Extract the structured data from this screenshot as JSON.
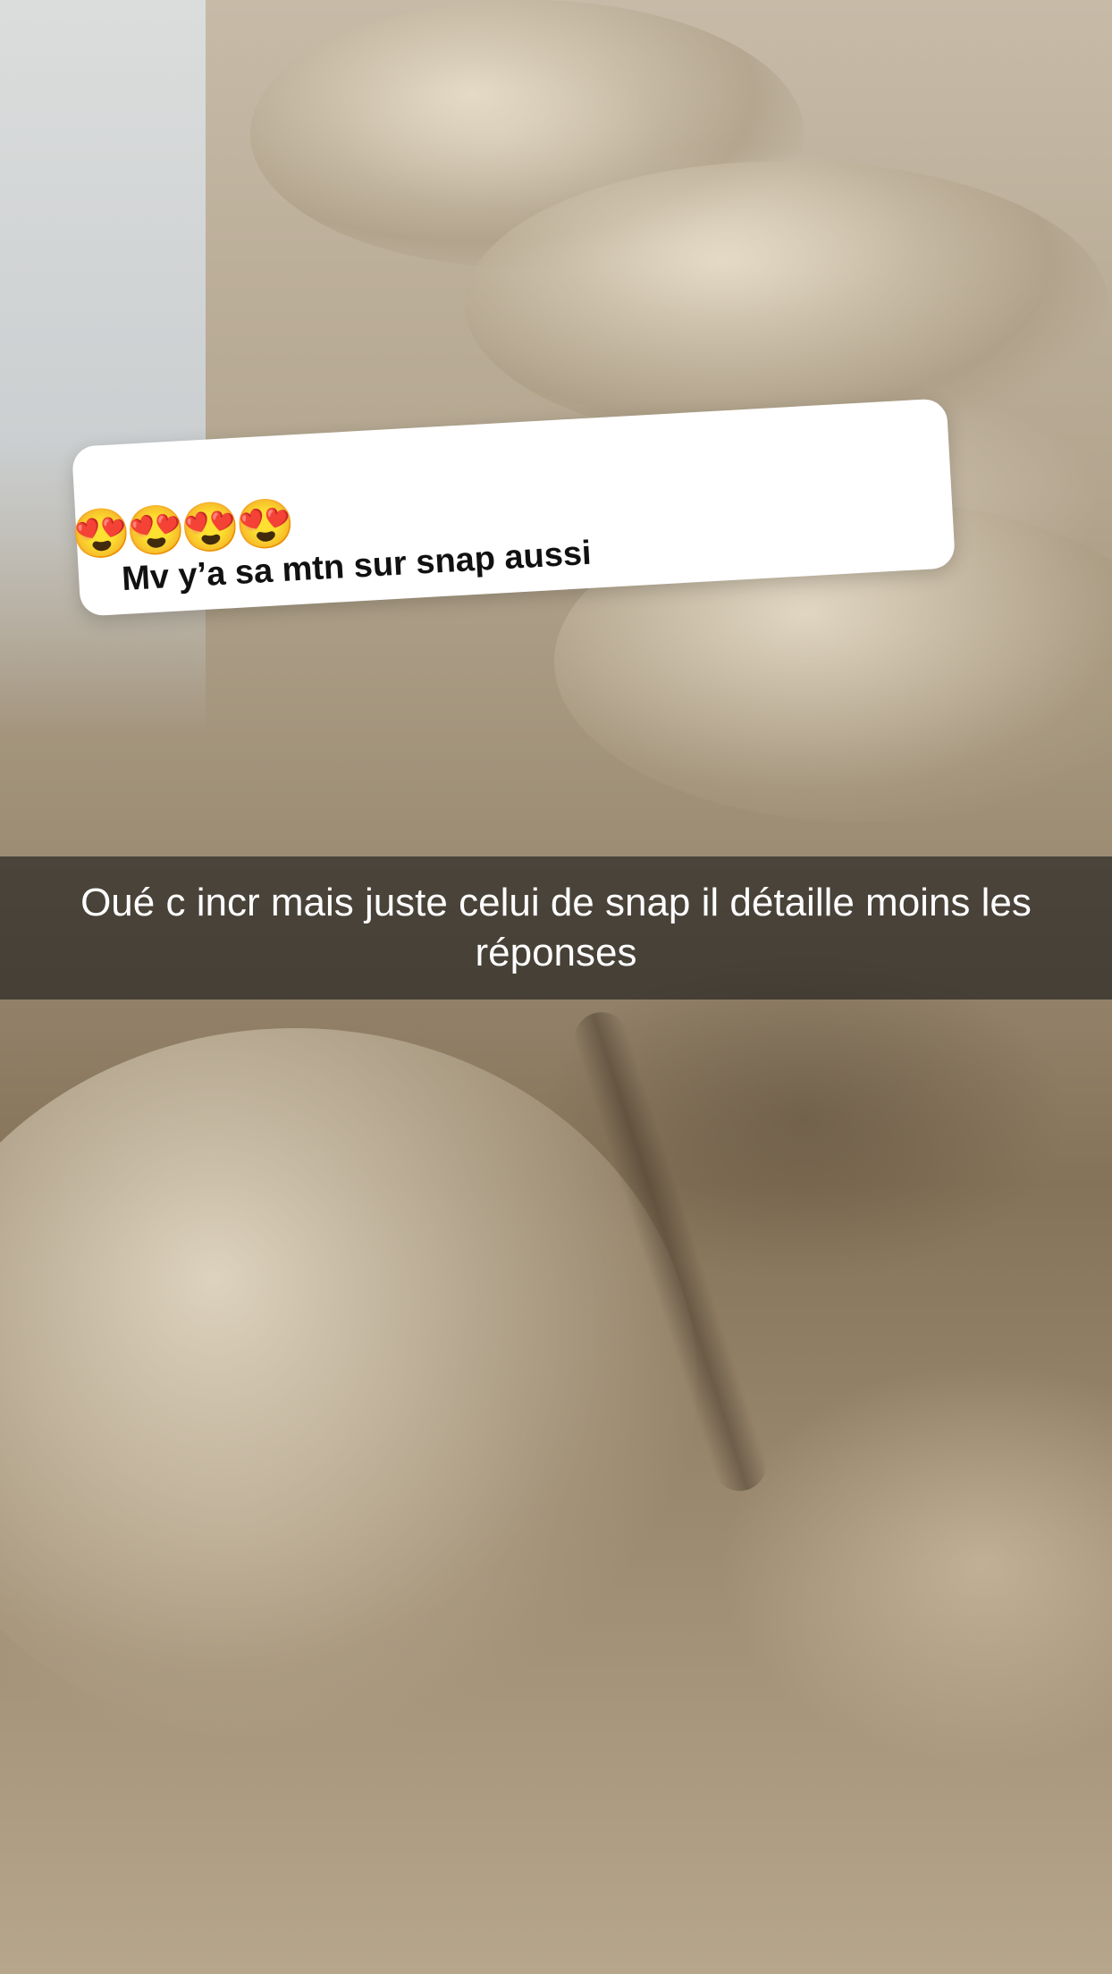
{
  "question_sticker": {
    "emojis": "😍😍😍😍",
    "emoji_icon": "heart-eyes-emoji",
    "text": "Mv y’a sa mtn sur snap aussi"
  },
  "caption": {
    "text": "Oué c incr mais juste celui de snap il détaille moins les réponses"
  },
  "colors": {
    "sticker_background": "#ffffff",
    "caption_bar": "rgba(20,20,20,0.6)",
    "caption_text": "#ffffff",
    "photo_tone": "#b3a58e"
  }
}
